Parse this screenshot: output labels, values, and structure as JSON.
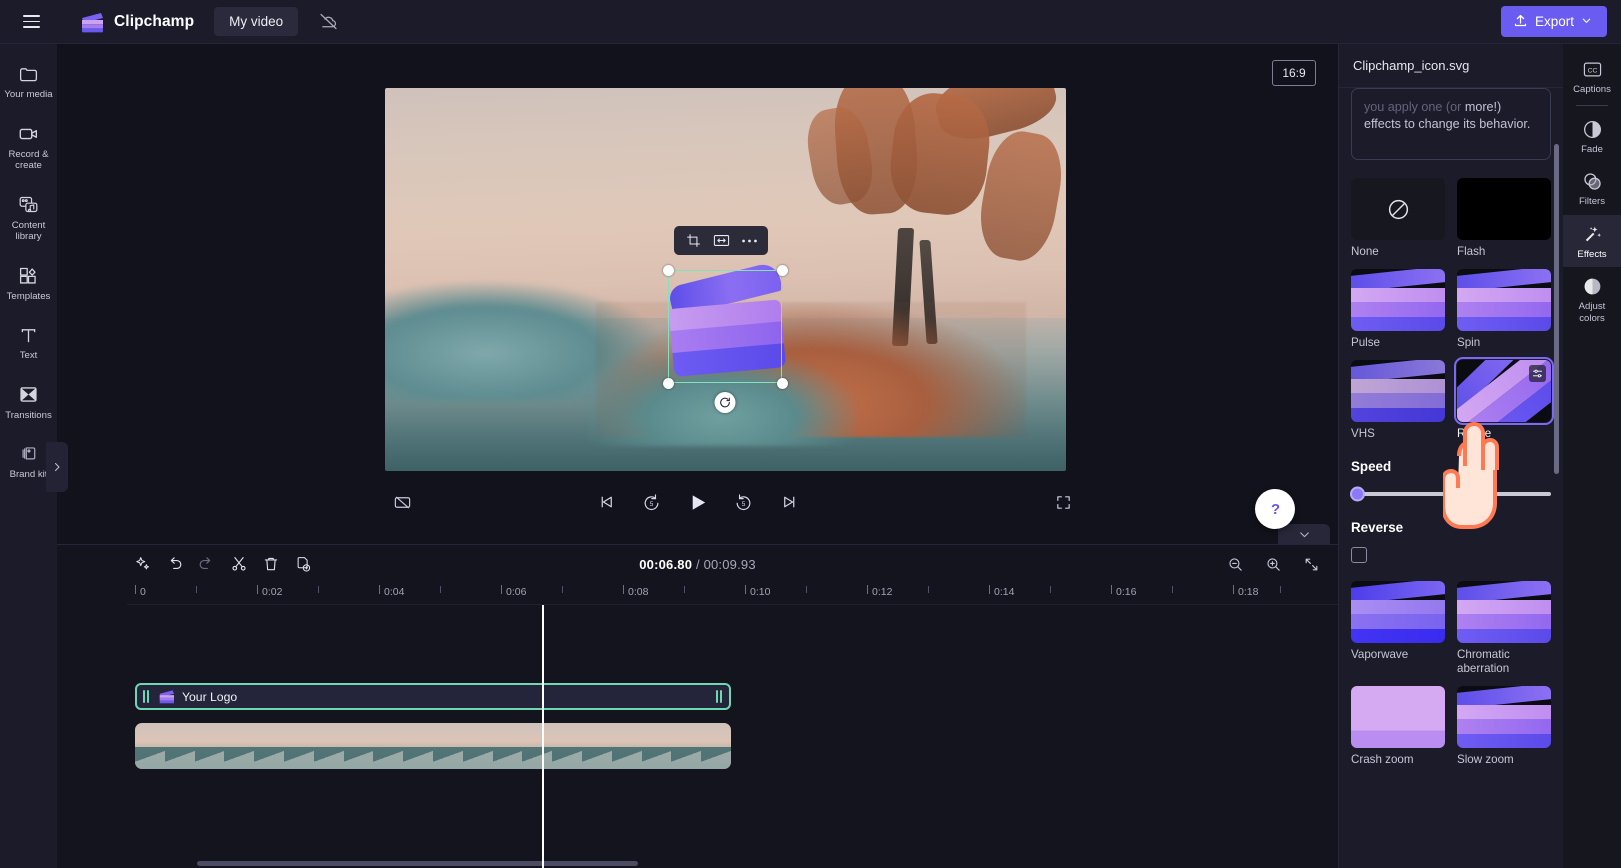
{
  "header": {
    "menu_icon": "hamburger-icon",
    "brand": "Clipchamp",
    "project_title": "My video",
    "cloud_icon": "cloud-off-icon",
    "export_label": "Export",
    "export_icon": "upload-icon",
    "accent": "#6a5cf0"
  },
  "left_rail": {
    "items": [
      {
        "label": "Your media",
        "icon": "folder-icon"
      },
      {
        "label": "Record & create",
        "icon": "video-camera-icon"
      },
      {
        "label": "Content library",
        "icon": "content-library-icon"
      },
      {
        "label": "Templates",
        "icon": "templates-grid-icon"
      },
      {
        "label": "Text",
        "icon": "text-t-icon"
      },
      {
        "label": "Transitions",
        "icon": "transitions-icon"
      },
      {
        "label": "Brand kit",
        "icon": "brand-kit-icon"
      }
    ],
    "expand_icon": "chevron-right-icon"
  },
  "stage": {
    "aspect_ratio": "16:9",
    "object_toolbar": [
      {
        "name": "crop-button",
        "icon": "crop-icon"
      },
      {
        "name": "fit-width-button",
        "icon": "fit-horizontal-icon"
      },
      {
        "name": "more-options-button",
        "icon": "ellipsis-icon"
      }
    ],
    "selection_color": "#86e0c0",
    "rotate_handle_icon": "rotate-icon"
  },
  "player": {
    "captions_toggle_icon": "captions-off-icon",
    "controls": [
      {
        "name": "skip-to-start-button",
        "icon": "skip-previous-icon"
      },
      {
        "name": "rewind-5s-button",
        "icon": "rewind-5-icon"
      },
      {
        "name": "play-button",
        "icon": "play-icon"
      },
      {
        "name": "forward-5s-button",
        "icon": "forward-5-icon"
      },
      {
        "name": "skip-to-end-button",
        "icon": "skip-next-icon"
      }
    ],
    "fullscreen_icon": "fullscreen-icon",
    "help_icon": "question-mark-icon",
    "collapse_icon": "chevron-down-icon"
  },
  "timeline": {
    "tools": [
      {
        "name": "magic-tools-button",
        "icon": "sparkle-icon"
      },
      {
        "name": "undo-button",
        "icon": "undo-arrow-icon"
      },
      {
        "name": "redo-button",
        "icon": "redo-arrow-icon"
      },
      {
        "name": "split-button",
        "icon": "scissors-icon"
      },
      {
        "name": "delete-button",
        "icon": "trash-icon"
      },
      {
        "name": "duplicate-button",
        "icon": "duplicate-icon"
      }
    ],
    "current_time": "00:06.80",
    "separator": "/",
    "total_time": "00:09.93",
    "zoom_out_icon": "zoom-out-icon",
    "zoom_in_icon": "zoom-in-icon",
    "fit_icon": "fit-timeline-icon",
    "ruler_ticks": [
      "0",
      "0:02",
      "0:04",
      "0:06",
      "0:08",
      "0:10",
      "0:12",
      "0:14",
      "0:16",
      "0:18"
    ],
    "clips": [
      {
        "name": "logo-clip",
        "label": "Your Logo",
        "type": "image",
        "selected": true
      },
      {
        "name": "video-clip",
        "label": "",
        "type": "video",
        "selected": false
      }
    ],
    "playhead_time": "00:06.80"
  },
  "right_panel": {
    "file_name": "Clipchamp_icon.svg",
    "tip_text_faded": "you apply one (or",
    "tip_text": "more!) effects to change its behavior.",
    "effects": [
      {
        "label": "None",
        "thumb": "none"
      },
      {
        "label": "Flash",
        "thumb": "flash"
      },
      {
        "label": "Pulse",
        "thumb": "clapper"
      },
      {
        "label": "Spin",
        "thumb": "clapper"
      },
      {
        "label": "VHS",
        "thumb": "vhs"
      },
      {
        "label": "Rotate",
        "thumb": "rotate",
        "selected": true,
        "settings_icon": "sliders-icon"
      },
      {
        "label": "Vaporwave",
        "thumb": "vaporwave"
      },
      {
        "label": "Chromatic aberration",
        "thumb": "chromatic"
      },
      {
        "label": "Crash zoom",
        "thumb": "crash"
      },
      {
        "label": "Slow zoom",
        "thumb": "slow"
      }
    ],
    "speed_label": "Speed",
    "speed_value": 0,
    "reverse_label": "Reverse",
    "reverse_checked": false,
    "selected_outline": "#7b68f5"
  },
  "right_rail": {
    "items": [
      {
        "label": "Captions",
        "icon": "cc-icon",
        "active": false
      },
      {
        "label": "Fade",
        "icon": "fade-icon",
        "active": false
      },
      {
        "label": "Filters",
        "icon": "filters-icon",
        "active": false
      },
      {
        "label": "Effects",
        "icon": "effects-wand-icon",
        "active": true
      },
      {
        "label": "Adjust colors",
        "icon": "adjust-colors-icon",
        "active": false
      }
    ]
  }
}
